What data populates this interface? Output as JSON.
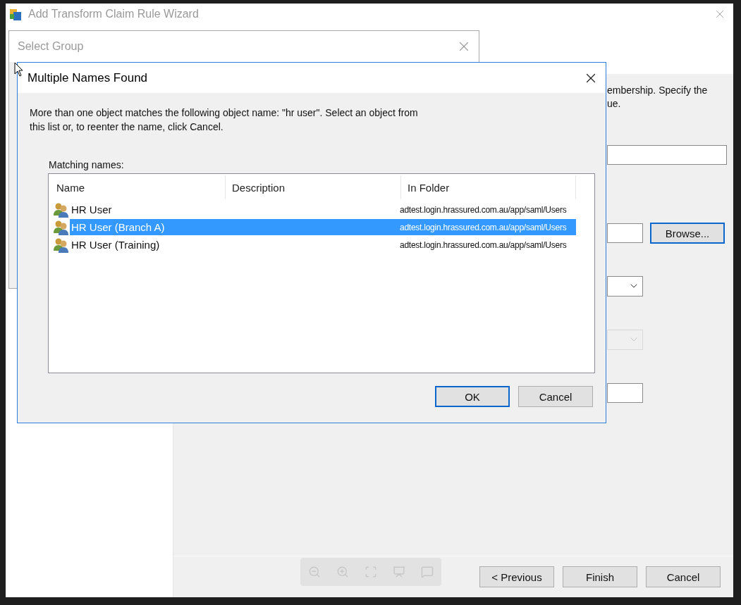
{
  "wizard": {
    "title": "Add Transform Claim Rule Wizard",
    "description": [
      "embership. Specify the",
      "ue."
    ],
    "fields": [
      {
        "kind": "text"
      },
      {
        "kind": "browse",
        "button": "Browse..."
      },
      {
        "kind": "dropdown",
        "disabled": false
      },
      {
        "kind": "dropdown",
        "disabled": true
      },
      {
        "kind": "text"
      }
    ],
    "buttons": [
      "< Previous",
      "Finish",
      "Cancel"
    ]
  },
  "select_group": {
    "title": "Select Group"
  },
  "dialog": {
    "title": "Multiple Names Found",
    "message": "More than one object matches the following object name: \"hr user\". Select an object from this list or, to reenter the name, click Cancel.",
    "list_label": "Matching names:",
    "columns": [
      "Name",
      "Description",
      "In Folder"
    ],
    "rows": [
      {
        "name": "HR User",
        "folder": "adtest.login.hrassured.com.au/app/saml/Users",
        "selected": false
      },
      {
        "name": "HR User (Branch A)",
        "folder": "adtest.login.hrassured.com.au/app/saml/Users",
        "selected": true
      },
      {
        "name": "HR User (Training)",
        "folder": "adtest.login.hrassured.com.au/app/saml/Users",
        "selected": false
      }
    ],
    "buttons": [
      {
        "label": "OK",
        "default": true
      },
      {
        "label": "Cancel",
        "default": false
      }
    ]
  }
}
